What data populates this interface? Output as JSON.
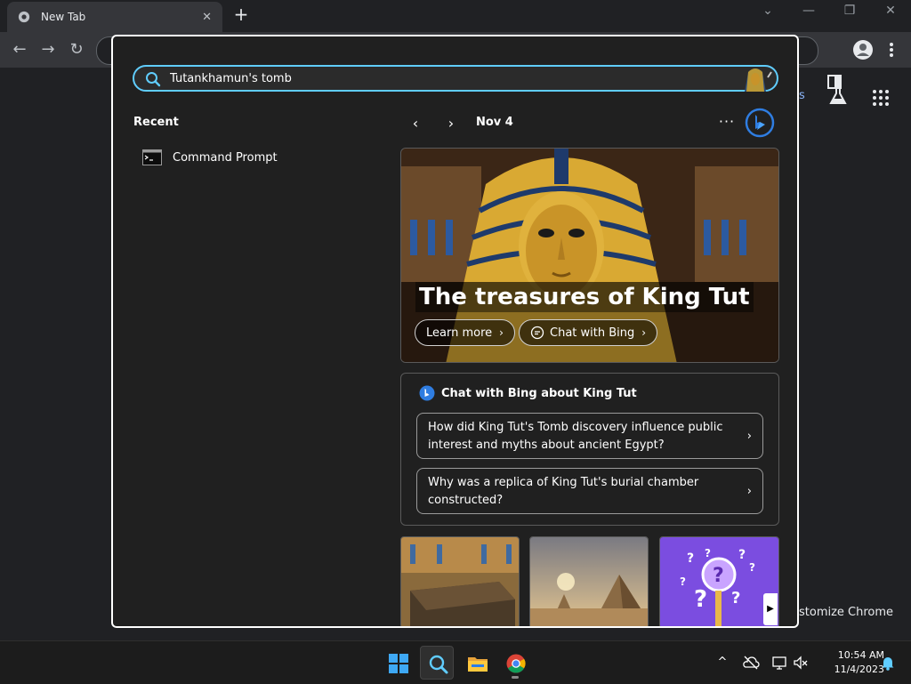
{
  "browser": {
    "tab_title": "New Tab",
    "tab_close": "✕",
    "new_tab": "+",
    "window_controls": {
      "dropdown": "⌄",
      "minimize": "—",
      "restore": "❐",
      "close": "✕"
    },
    "back": "←",
    "forward": "→",
    "reload": "↻",
    "page_partial_link": "s",
    "customize_text": "stomize Chrome"
  },
  "flyout": {
    "search": {
      "value": "Tutankhamun's tomb"
    },
    "recent": {
      "title": "Recent",
      "items": [
        {
          "label": "Command Prompt"
        }
      ]
    },
    "nav": {
      "prev": "‹",
      "next": "›",
      "date": "Nov 4",
      "more": "···"
    },
    "hero": {
      "title": "The treasures of King Tut",
      "learn_more": "Learn more",
      "chat_with_bing": "Chat with Bing",
      "chevron": "›"
    },
    "chat_card": {
      "title": "Chat with Bing about King Tut",
      "questions": [
        "How did King Tut's Tomb discovery influence public interest and myths about ancient Egypt?",
        "Why was a replica of King Tut's burial chamber constructed?"
      ],
      "chevron": "›"
    },
    "scroll_next": "▶"
  },
  "taskbar": {
    "clock_time": "10:54 AM",
    "clock_date": "11/4/2023",
    "tray_chevron": "^"
  },
  "colors": {
    "accent": "#60cdff",
    "flyout_bg": "#202020",
    "chrome_toolbar": "#35363a",
    "chrome_bg": "#202124"
  }
}
